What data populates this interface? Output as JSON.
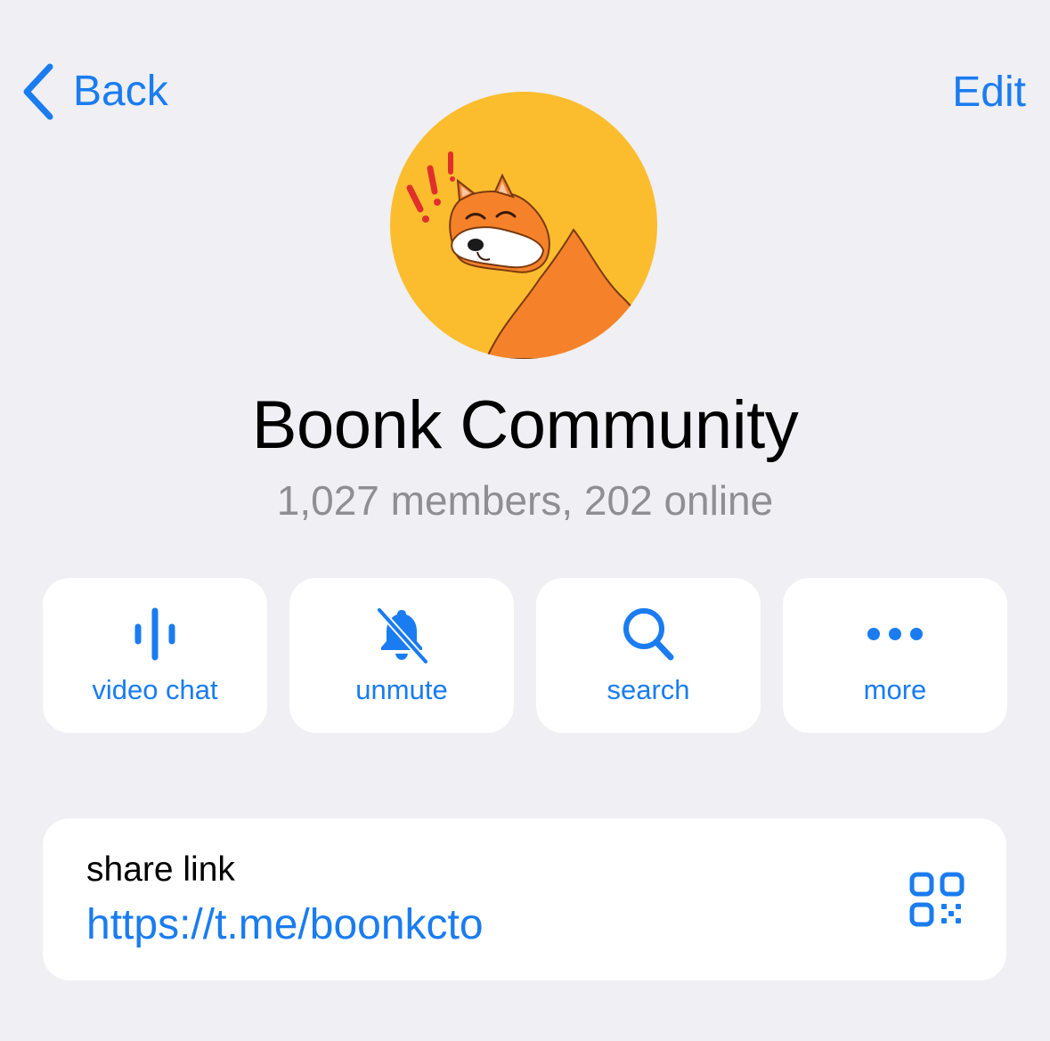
{
  "nav": {
    "back_label": "Back",
    "edit_label": "Edit",
    "back_icon": "chevron-left-icon"
  },
  "group": {
    "title": "Boonk Community",
    "subtitle": "1,027 members, 202 online"
  },
  "actions": [
    {
      "label": "video chat",
      "icon": "voice-chat-icon"
    },
    {
      "label": "unmute",
      "icon": "bell-slash-icon"
    },
    {
      "label": "search",
      "icon": "search-icon"
    },
    {
      "label": "more",
      "icon": "ellipsis-icon"
    }
  ],
  "share": {
    "label": "share link",
    "url": "https://t.me/boonkcto",
    "icon": "qr-code-icon"
  },
  "colors": {
    "accent": "#1a7cf0",
    "background": "#efeff4",
    "card": "#ffffff",
    "secondary_text": "#8e8e93",
    "avatar_background": "#fbbd2e",
    "avatar_character": "#f5822a"
  }
}
